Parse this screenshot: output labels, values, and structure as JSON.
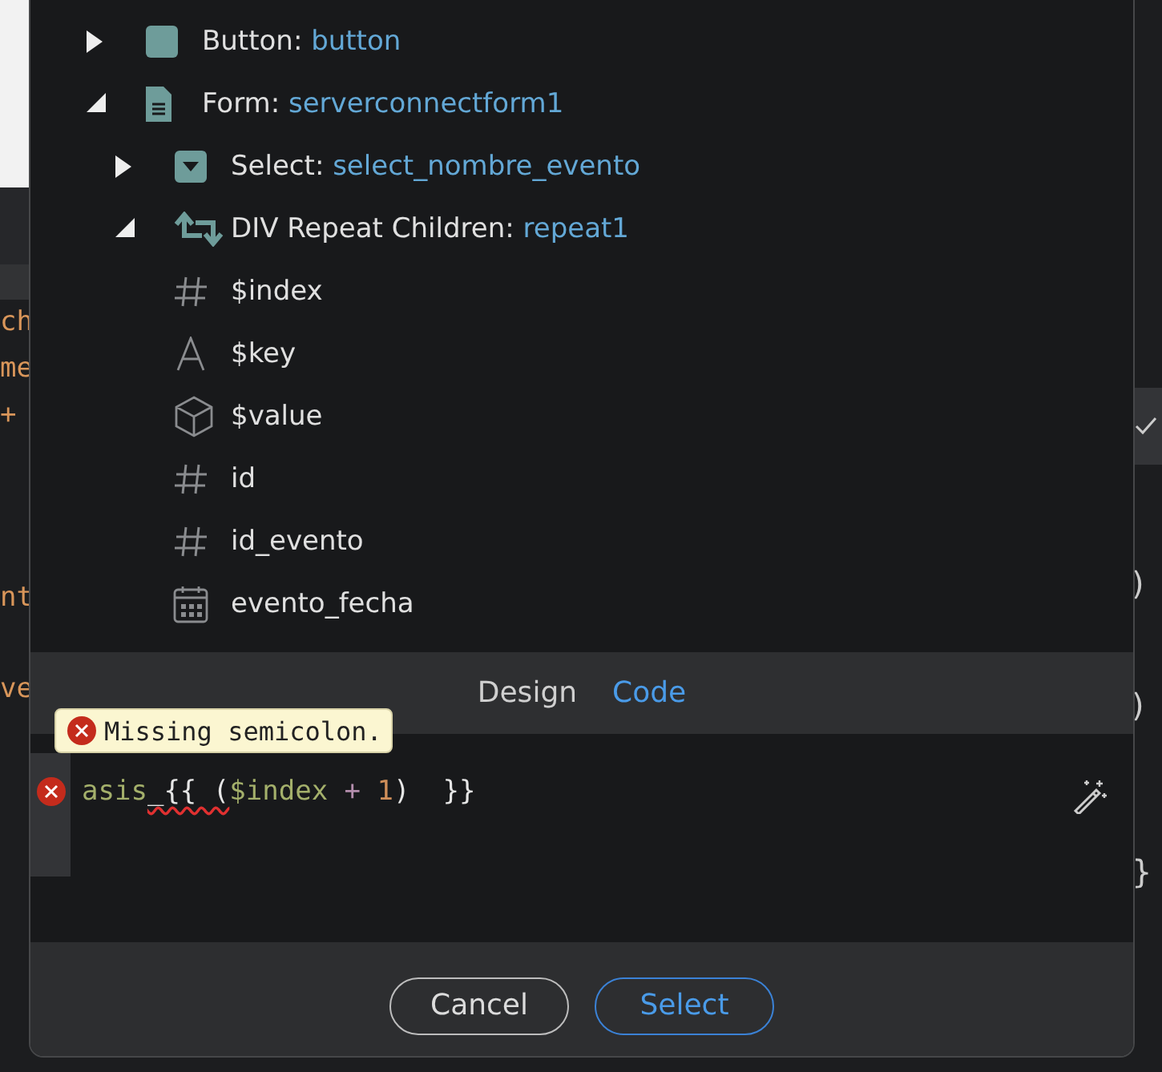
{
  "background": {
    "left_fragments": [
      "ch",
      "me",
      "+",
      "nt",
      "ve"
    ],
    "right_fragments": [
      ")",
      ")",
      "}"
    ]
  },
  "tree": [
    {
      "label": "Button:",
      "name": "button",
      "kind": "button",
      "expanded": false
    },
    {
      "label": "Form:",
      "name": "serverconnectform1",
      "kind": "form",
      "expanded": true,
      "children": [
        {
          "label": "Select:",
          "name": "select_nombre_evento",
          "kind": "select",
          "expanded": false
        },
        {
          "label": "DIV Repeat Children:",
          "name": "repeat1",
          "kind": "repeat",
          "expanded": true,
          "children": [
            {
              "label": "$index",
              "kind": "number"
            },
            {
              "label": "$key",
              "kind": "text"
            },
            {
              "label": "$value",
              "kind": "object"
            },
            {
              "label": "id",
              "kind": "number"
            },
            {
              "label": "id_evento",
              "kind": "number"
            },
            {
              "label": "evento_fecha",
              "kind": "date"
            }
          ]
        }
      ]
    }
  ],
  "tabs": [
    {
      "label": "Design",
      "selected": false
    },
    {
      "label": "Code",
      "selected": true
    }
  ],
  "tooltip": "Missing semicolon.",
  "code": {
    "has_error": true,
    "tokens": [
      {
        "text": "asis",
        "kind": "text",
        "error": false
      },
      {
        "text": "_{{ (",
        "kind": "punct",
        "error": true
      },
      {
        "text": "$index",
        "kind": "variable",
        "error": false
      },
      {
        "text": " + ",
        "kind": "operator",
        "error": false
      },
      {
        "text": "1",
        "kind": "number",
        "error": false
      },
      {
        "text": ")  }}",
        "kind": "punct",
        "error": false
      }
    ]
  },
  "buttons": [
    {
      "label": "Cancel",
      "kind": "secondary"
    },
    {
      "label": "Select",
      "kind": "primary"
    }
  ]
}
